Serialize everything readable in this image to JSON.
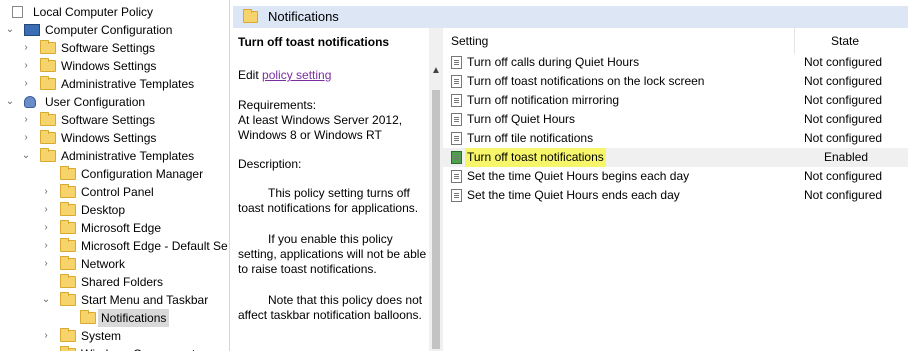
{
  "tree": [
    {
      "label": "Local Computer Policy",
      "level": 0,
      "expander": "",
      "icon": "document-icon"
    },
    {
      "label": "Computer Configuration",
      "level": 1,
      "expander": "expanded",
      "icon": "computer-icon"
    },
    {
      "label": "Software Settings",
      "level": 2,
      "expander": "collapsed",
      "icon": "folder-icon"
    },
    {
      "label": "Windows Settings",
      "level": 2,
      "expander": "collapsed",
      "icon": "folder-icon"
    },
    {
      "label": "Administrative Templates",
      "level": 2,
      "expander": "collapsed",
      "icon": "folder-icon"
    },
    {
      "label": "User Configuration",
      "level": 1,
      "expander": "expanded",
      "icon": "user-icon"
    },
    {
      "label": "Software Settings",
      "level": 2,
      "expander": "collapsed",
      "icon": "folder-icon"
    },
    {
      "label": "Windows Settings",
      "level": 2,
      "expander": "collapsed",
      "icon": "folder-icon"
    },
    {
      "label": "Administrative Templates",
      "level": 2,
      "expander": "expanded",
      "icon": "folder-icon"
    },
    {
      "label": "Configuration Manager",
      "level": 3,
      "expander": "",
      "icon": "folder-icon"
    },
    {
      "label": "Control Panel",
      "level": 3,
      "expander": "collapsed",
      "icon": "folder-icon"
    },
    {
      "label": "Desktop",
      "level": 3,
      "expander": "collapsed",
      "icon": "folder-icon"
    },
    {
      "label": "Microsoft Edge",
      "level": 3,
      "expander": "collapsed",
      "icon": "folder-icon"
    },
    {
      "label": "Microsoft Edge - Default Se",
      "level": 3,
      "expander": "collapsed",
      "icon": "folder-icon"
    },
    {
      "label": "Network",
      "level": 3,
      "expander": "collapsed",
      "icon": "folder-icon"
    },
    {
      "label": "Shared Folders",
      "level": 3,
      "expander": "",
      "icon": "folder-icon"
    },
    {
      "label": "Start Menu and Taskbar",
      "level": 3,
      "expander": "expanded",
      "icon": "folder-icon"
    },
    {
      "label": "Notifications",
      "level": 4,
      "expander": "",
      "icon": "folder-icon",
      "selected": true
    },
    {
      "label": "System",
      "level": 3,
      "expander": "collapsed",
      "icon": "folder-icon"
    },
    {
      "label": "Windows Components",
      "level": 3,
      "expander": "collapsed",
      "icon": "folder-icon"
    }
  ],
  "header": {
    "title": "Notifications"
  },
  "description": {
    "title": "Turn off toast notifications",
    "edit_prefix": "Edit",
    "edit_link": "policy setting",
    "requirements_label": "Requirements:",
    "requirements_text": "At least Windows Server 2012, Windows 8 or Windows RT",
    "description_label": "Description:",
    "para1": "This policy setting turns off toast notifications for applications.",
    "para2": "If you enable this policy setting, applications will not be able to raise toast notifications.",
    "para3": "Note that this policy does not affect taskbar notification balloons."
  },
  "columns": {
    "setting": "Setting",
    "state": "State"
  },
  "settings": [
    {
      "name": "Turn off calls during Quiet Hours",
      "state": "Not configured"
    },
    {
      "name": "Turn off toast notifications on the lock screen",
      "state": "Not configured"
    },
    {
      "name": "Turn off notification mirroring",
      "state": "Not configured"
    },
    {
      "name": "Turn off Quiet Hours",
      "state": "Not configured"
    },
    {
      "name": "Turn off tile notifications",
      "state": "Not configured"
    },
    {
      "name": "Turn off toast notifications",
      "state": "Enabled",
      "highlighted": true
    },
    {
      "name": "Set the time Quiet Hours begins each day",
      "state": "Not configured"
    },
    {
      "name": "Set the time Quiet Hours ends each day",
      "state": "Not configured"
    }
  ],
  "colors": {
    "header_bar": "#dce6f4",
    "highlight": "#f7f56a",
    "link": "#7a2ea0",
    "enabled_icon": "#4ea24e"
  }
}
